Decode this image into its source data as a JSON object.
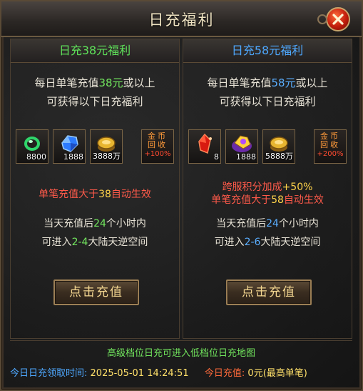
{
  "window": {
    "title": "日充福利"
  },
  "left": {
    "header": "日充38元福利",
    "desc_l1_a": "每日单笔充值",
    "desc_l1_b": "38元",
    "desc_l1_c": "或以上",
    "desc_l2": "可获得以下日充福利",
    "items": [
      {
        "icon": "jade-ring-icon",
        "count": "8800"
      },
      {
        "icon": "blue-gem-icon",
        "count": "1888"
      },
      {
        "icon": "gold-coin-icon",
        "count": "3888万"
      }
    ],
    "bonus": {
      "l1": "金币",
      "l2": "回收",
      "l3": "+100%"
    },
    "effect_a": "单笔充值大于",
    "effect_b": "38",
    "effect_c": "自动生效",
    "rule1_a": "当天充值后",
    "rule1_b": "24",
    "rule1_c": "个小时内",
    "rule2_a": "可进入",
    "rule2_b": "2-4",
    "rule2_c": "大陆天逆空间",
    "button": "点击充值"
  },
  "right": {
    "header": "日充58元福利",
    "desc_l1_a": "每日单笔充值",
    "desc_l1_b": "58元",
    "desc_l1_c": "或以上",
    "desc_l2": "可获得以下日充福利",
    "items": [
      {
        "icon": "red-crystal-icon",
        "count": "8"
      },
      {
        "icon": "purple-treasure-icon",
        "count": "1888"
      },
      {
        "icon": "gold-coin-icon",
        "count": "5888万"
      }
    ],
    "bonus": {
      "l1": "金币",
      "l2": "回收",
      "l3": "+200%"
    },
    "extra_a": "跨服积分加成",
    "extra_b": "+50%",
    "effect_a": "单笔充值大于",
    "effect_b": "58",
    "effect_c": "自动生效",
    "rule1_a": "当天充值后",
    "rule1_b": "24",
    "rule1_c": "个小时内",
    "rule2_a": "可进入",
    "rule2_b": "2-6",
    "rule2_c": "大陆天逆空间",
    "button": "点击充值"
  },
  "footer": {
    "note": "高级档位日充可进入低档位日充地图",
    "claim_label": "今日日充领取时间:",
    "claim_time": "2025-05-01 14:24:51",
    "today_label": "今日充值:",
    "today_value": "0元(最高单笔)"
  }
}
